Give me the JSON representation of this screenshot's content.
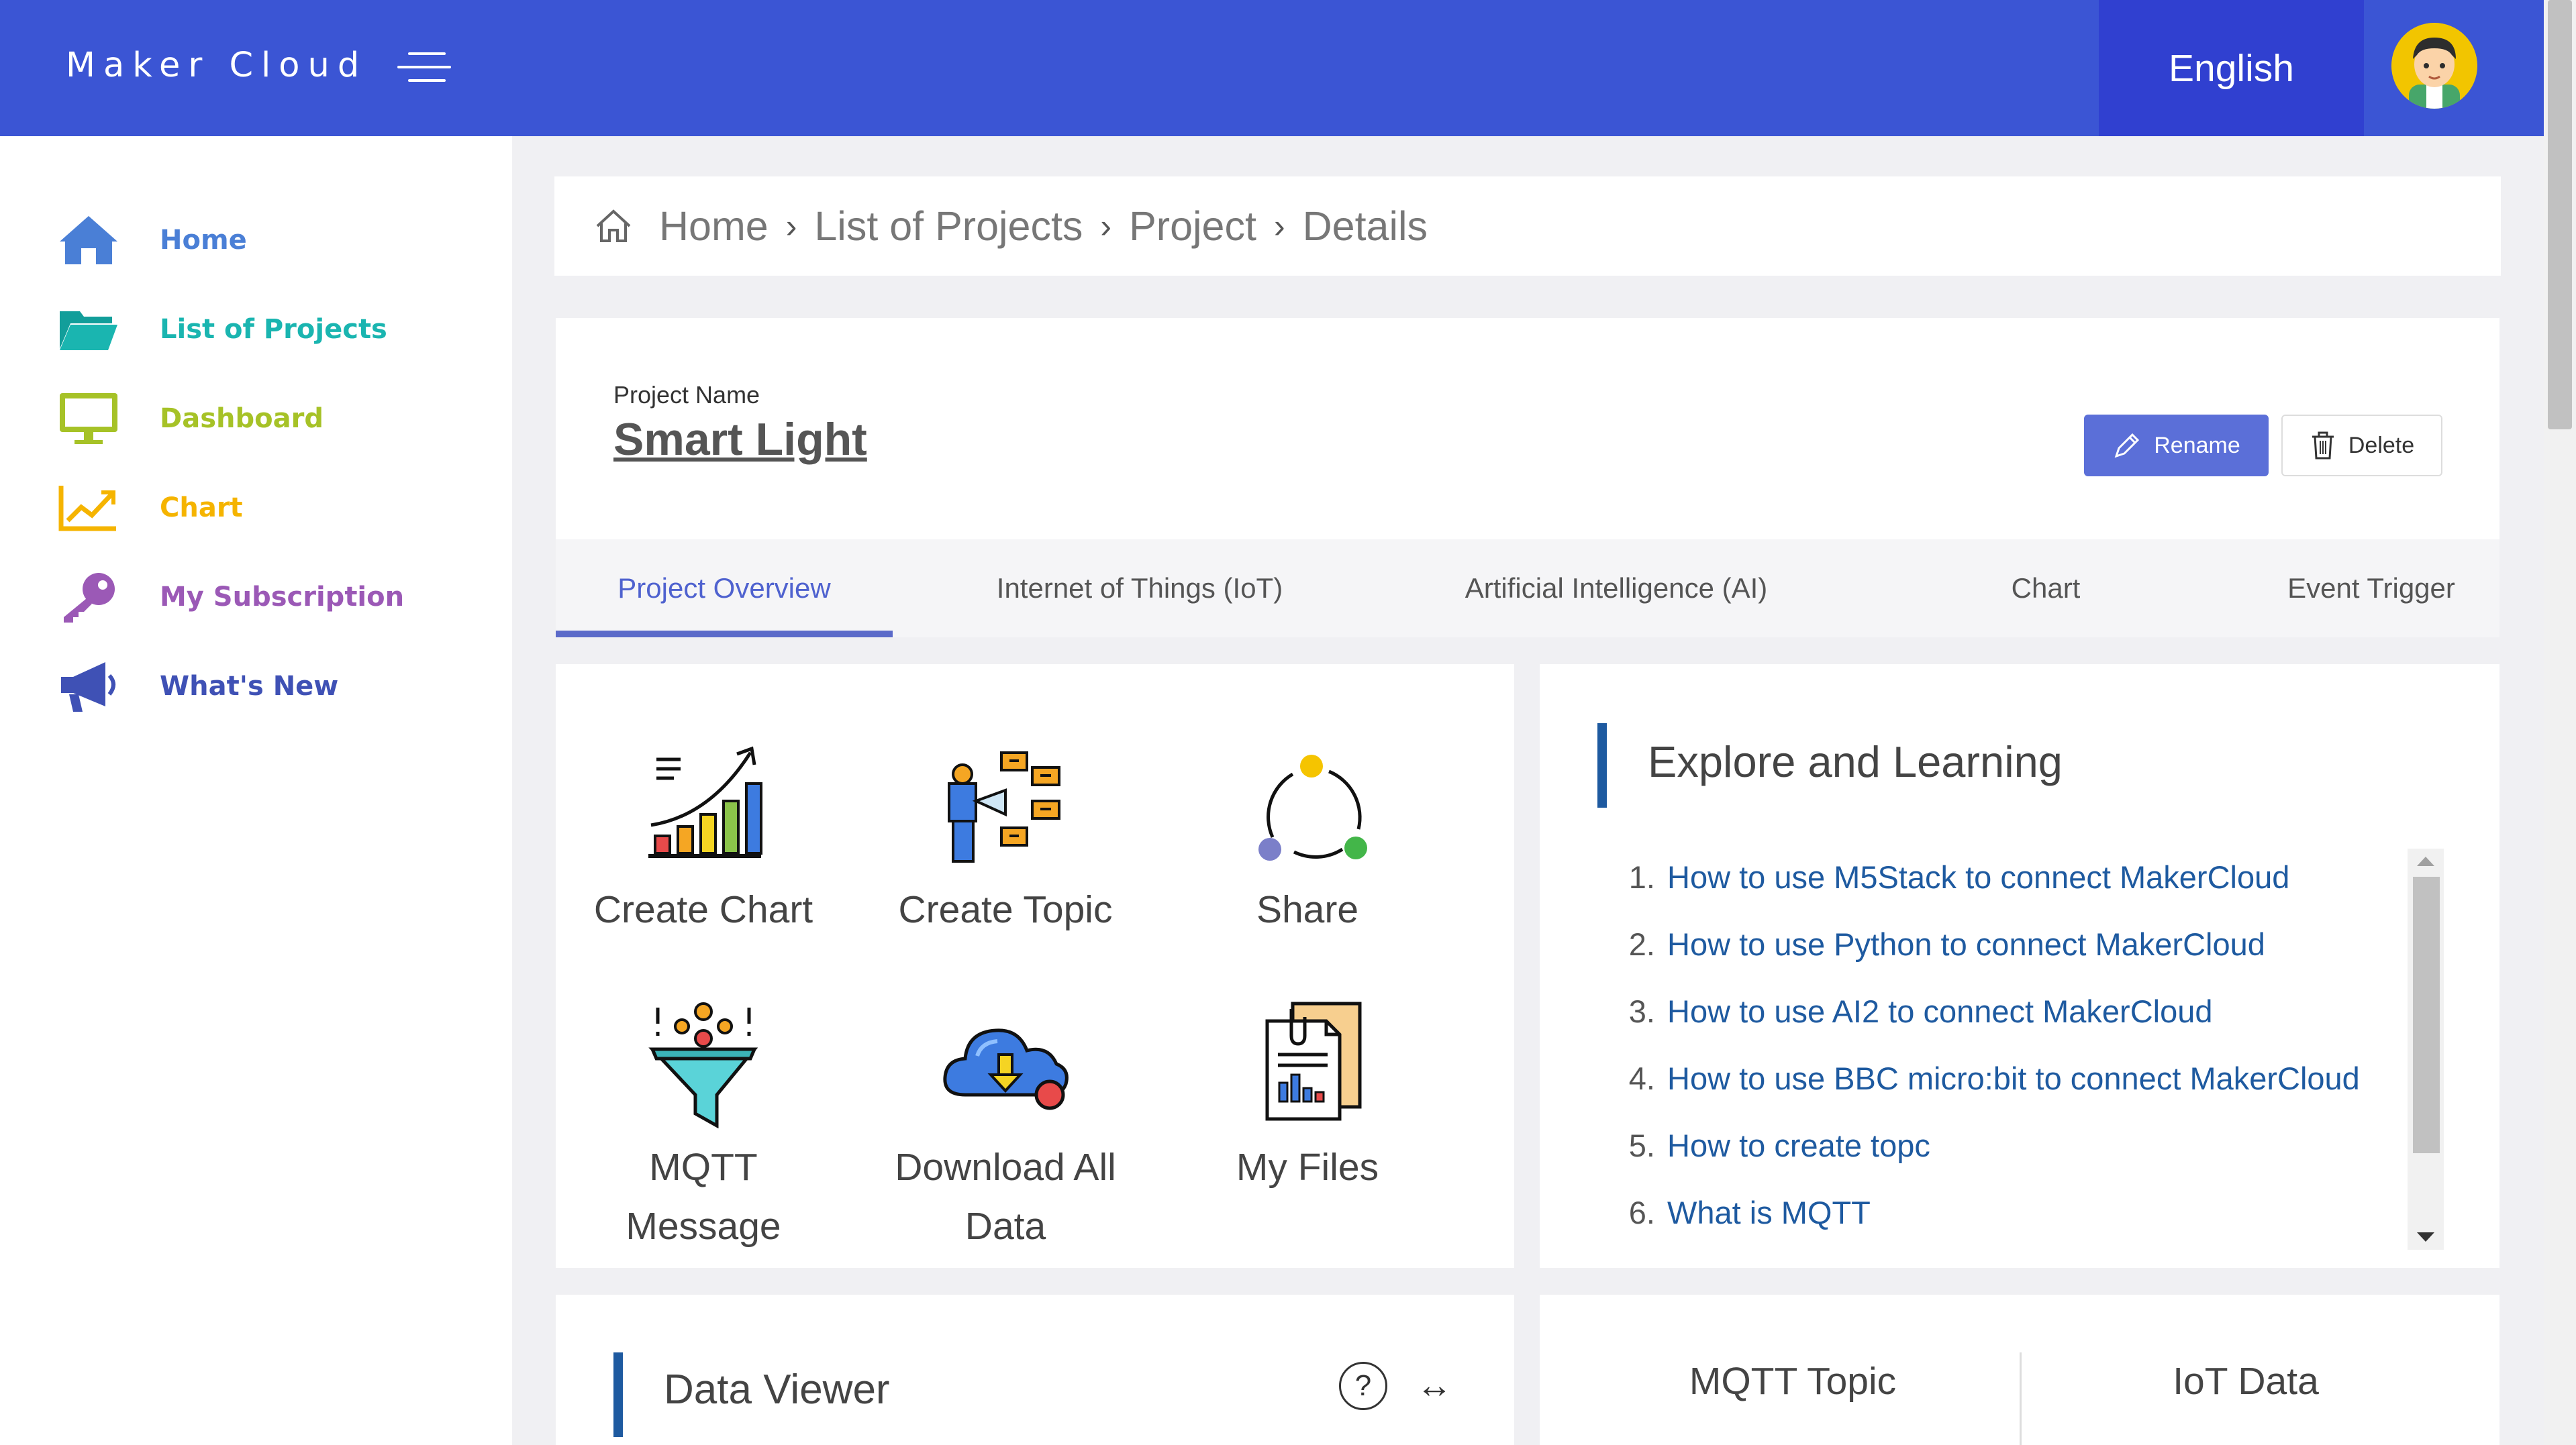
{
  "header": {
    "brand": "Maker Cloud",
    "language": "English"
  },
  "sidebar": {
    "items": [
      {
        "label": "Home",
        "icon": "home-icon",
        "color": "#4a7fd6"
      },
      {
        "label": "List of Projects",
        "icon": "folder-icon",
        "color": "#1ab5b0"
      },
      {
        "label": "Dashboard",
        "icon": "monitor-icon",
        "color": "#a6c227"
      },
      {
        "label": "Chart",
        "icon": "chart-line-icon",
        "color": "#f5b400"
      },
      {
        "label": "My Subscription",
        "icon": "key-icon",
        "color": "#9b59b6"
      },
      {
        "label": "What's New",
        "icon": "megaphone-icon",
        "color": "#3f51b5"
      }
    ]
  },
  "breadcrumb": [
    "Home",
    "List of Projects",
    "Project",
    "Details"
  ],
  "project": {
    "label": "Project Name",
    "name": "Smart Light",
    "rename": "Rename",
    "delete": "Delete"
  },
  "tabs": [
    "Project Overview",
    "Internet of Things (IoT)",
    "Artificial Intelligence (AI)",
    "Chart",
    "Event Trigger"
  ],
  "actions": {
    "create_chart": "Create Chart",
    "create_topic": "Create Topic",
    "share": "Share",
    "mqtt_message_1": "MQTT",
    "mqtt_message_2": "Message",
    "download_1": "Download All",
    "download_2": "Data",
    "my_files": "My Files"
  },
  "explore": {
    "title": "Explore and Learning",
    "items": [
      {
        "num": "1.",
        "text": "How to use M5Stack to connect MakerCloud"
      },
      {
        "num": "2.",
        "text": "How to use Python to connect MakerCloud"
      },
      {
        "num": "3.",
        "text": "How to use AI2 to connect MakerCloud"
      },
      {
        "num": "4.",
        "text": "How to use BBC micro:bit to connect MakerCloud"
      },
      {
        "num": "5.",
        "text": "How to create topc"
      },
      {
        "num": "6.",
        "text": "What is MQTT"
      }
    ]
  },
  "data_viewer": {
    "title": "Data Viewer",
    "help": "?",
    "expand": "↔"
  },
  "mqtt": {
    "topic": "MQTT Topic",
    "iot_data": "IoT Data"
  }
}
